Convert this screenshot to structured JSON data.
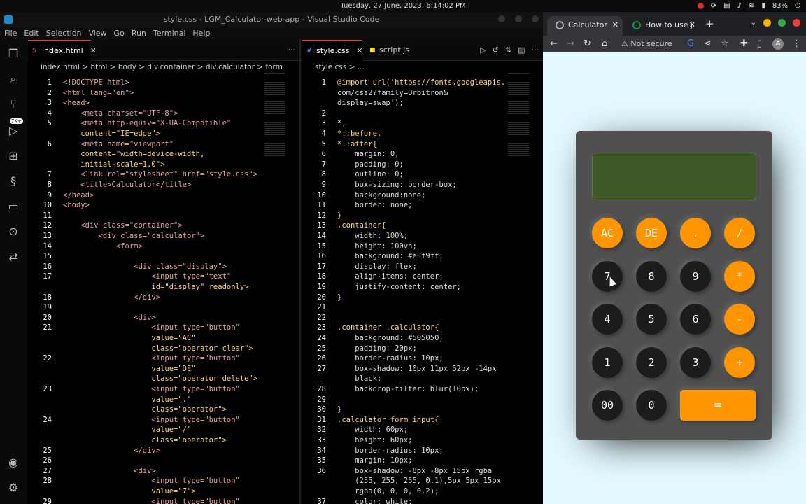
{
  "system": {
    "datetime": "Tuesday, 27 June, 2023",
    "time": "6:14:02 PM",
    "battery": "83%"
  },
  "vscode": {
    "window_title": "style.css - LGM_Calculator-web-app - Visual Studio Code",
    "menu": [
      "File",
      "Edit",
      "Selection",
      "View",
      "Go",
      "Run",
      "Terminal",
      "Help"
    ],
    "badge": "7K+",
    "left": {
      "tab": "index.html",
      "breadcrumb": "index.html > html > body > div.container > div.calculator > form",
      "lines": [
        {
          "n": "1",
          "t": "<!DOCTYPE html>"
        },
        {
          "n": "2",
          "t": "<html lang=\"en\">"
        },
        {
          "n": "3",
          "t": "<head>"
        },
        {
          "n": "4",
          "t": "    <meta charset=\"UTF-8\">"
        },
        {
          "n": "5",
          "t": "    <meta http-equiv=\"X-UA-Compatible\""
        },
        {
          "n": "",
          "t": "    content=\"IE=edge\">"
        },
        {
          "n": "6",
          "t": "    <meta name=\"viewport\""
        },
        {
          "n": "",
          "t": "    content=\"width=device-width,"
        },
        {
          "n": "",
          "t": "    initial-scale=1.0\">"
        },
        {
          "n": "7",
          "t": "    <link rel=\"stylesheet\" href=\"style.css\">"
        },
        {
          "n": "8",
          "t": "    <title>Calculator</title>"
        },
        {
          "n": "9",
          "t": "</head>"
        },
        {
          "n": "10",
          "t": "<body>"
        },
        {
          "n": "11",
          "t": ""
        },
        {
          "n": "12",
          "t": "    <div class=\"container\">"
        },
        {
          "n": "13",
          "t": "        <div class=\"calculator\">"
        },
        {
          "n": "14",
          "t": "            <form>"
        },
        {
          "n": "15",
          "t": ""
        },
        {
          "n": "16",
          "t": "                <div class=\"display\">"
        },
        {
          "n": "17",
          "t": "                    <input type=\"text\""
        },
        {
          "n": "",
          "t": "                    id=\"display\" readonly>"
        },
        {
          "n": "18",
          "t": "                </div>"
        },
        {
          "n": "19",
          "t": ""
        },
        {
          "n": "20",
          "t": "                <div>"
        },
        {
          "n": "21",
          "t": "                    <input type=\"button\""
        },
        {
          "n": "",
          "t": "                    value=\"AC\""
        },
        {
          "n": "",
          "t": "                    class=\"operator clear\">"
        },
        {
          "n": "22",
          "t": "                    <input type=\"button\""
        },
        {
          "n": "",
          "t": "                    value=\"DE\""
        },
        {
          "n": "",
          "t": "                    class=\"operator delete\">"
        },
        {
          "n": "23",
          "t": "                    <input type=\"button\""
        },
        {
          "n": "",
          "t": "                    value=\".\""
        },
        {
          "n": "",
          "t": "                    class=\"operator\">"
        },
        {
          "n": "24",
          "t": "                    <input type=\"button\""
        },
        {
          "n": "",
          "t": "                    value=\"/\""
        },
        {
          "n": "",
          "t": "                    class=\"operator\">"
        },
        {
          "n": "25",
          "t": "                </div>"
        },
        {
          "n": "26",
          "t": ""
        },
        {
          "n": "27",
          "t": "                <div>"
        },
        {
          "n": "28",
          "t": "                    <input type=\"button\""
        },
        {
          "n": "",
          "t": "                    value=\"7\">"
        },
        {
          "n": "29",
          "t": "                    <input type=\"button\""
        }
      ]
    },
    "right": {
      "tabs": [
        "style.css",
        "script.js"
      ],
      "breadcrumb": "style.css > ...",
      "lines": [
        {
          "n": "1",
          "t": "@import url('https://fonts.googleapis."
        },
        {
          "n": "",
          "t": "com/css2?family=Orbitron&"
        },
        {
          "n": "",
          "t": "display=swap');"
        },
        {
          "n": "2",
          "t": ""
        },
        {
          "n": "3",
          "t": "*,"
        },
        {
          "n": "4",
          "t": "*::before,"
        },
        {
          "n": "5",
          "t": "*::after{"
        },
        {
          "n": "6",
          "t": "    margin: 0;"
        },
        {
          "n": "7",
          "t": "    padding: 0;"
        },
        {
          "n": "8",
          "t": "    outline: 0;"
        },
        {
          "n": "9",
          "t": "    box-sizing: border-box;"
        },
        {
          "n": "10",
          "t": "    background:none;"
        },
        {
          "n": "11",
          "t": "    border: none;"
        },
        {
          "n": "12",
          "t": "}"
        },
        {
          "n": "13",
          "t": ".container{"
        },
        {
          "n": "14",
          "t": "    width: 100%;"
        },
        {
          "n": "15",
          "t": "    height: 100vh;"
        },
        {
          "n": "16",
          "t": "    background: #e3f9ff;"
        },
        {
          "n": "17",
          "t": "    display: flex;"
        },
        {
          "n": "18",
          "t": "    align-items: center;"
        },
        {
          "n": "19",
          "t": "    justify-content: center;"
        },
        {
          "n": "20",
          "t": "}"
        },
        {
          "n": "21",
          "t": ""
        },
        {
          "n": "22",
          "t": ""
        },
        {
          "n": "23",
          "t": ".container .calculator{"
        },
        {
          "n": "24",
          "t": "    background: #505050;"
        },
        {
          "n": "25",
          "t": "    padding: 20px;"
        },
        {
          "n": "26",
          "t": "    border-radius: 10px;"
        },
        {
          "n": "27",
          "t": "    box-shadow: 10px 11px 52px -14px"
        },
        {
          "n": "",
          "t": "    black;"
        },
        {
          "n": "28",
          "t": "    backdrop-filter: blur(10px);"
        },
        {
          "n": "29",
          "t": ""
        },
        {
          "n": "30",
          "t": "}"
        },
        {
          "n": "31",
          "t": ".calculator form input{"
        },
        {
          "n": "32",
          "t": "    width: 60px;"
        },
        {
          "n": "33",
          "t": "    height: 60px;"
        },
        {
          "n": "34",
          "t": "    border-radius: 10px;"
        },
        {
          "n": "35",
          "t": "    margin: 10px;"
        },
        {
          "n": "36",
          "t": "    box-shadow: -8px -8px 15px rgba"
        },
        {
          "n": "",
          "t": "    (255, 255, 255, 0.1),5px 5px 15px"
        },
        {
          "n": "",
          "t": "    rgba(0, 0, 0, 0.2);"
        },
        {
          "n": "37",
          "t": "    color: white;"
        }
      ]
    }
  },
  "browser": {
    "tabs": [
      "Calculator",
      "How to use j"
    ],
    "address": "Not secure",
    "avatar": "A",
    "calculator": {
      "display": "",
      "rows": [
        [
          "AC",
          "DE",
          ".",
          "/"
        ],
        [
          "7",
          "8",
          "9",
          "*"
        ],
        [
          "4",
          "5",
          "6",
          "-"
        ],
        [
          "1",
          "2",
          "3",
          "+"
        ],
        [
          "00",
          "0",
          "="
        ]
      ]
    }
  }
}
